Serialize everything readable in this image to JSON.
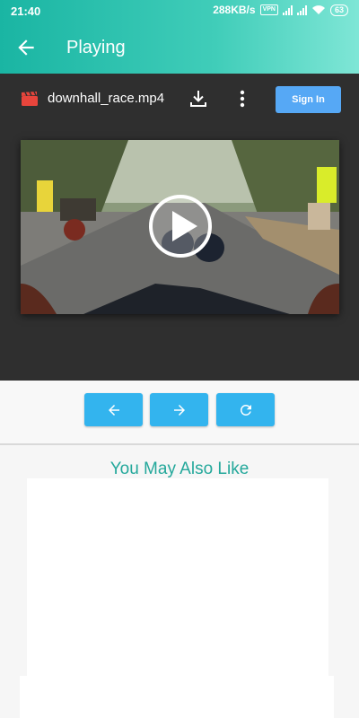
{
  "status": {
    "time": "21:40",
    "speed": "288KB/s",
    "vpn": "VPN",
    "battery": "63"
  },
  "appbar": {
    "title": "Playing",
    "back_icon": "arrow-left-icon"
  },
  "file": {
    "name": "downhall_race.mp4",
    "icon": "clapperboard-icon"
  },
  "actions": {
    "download_icon": "download-icon",
    "more_icon": "more-vert-icon",
    "signin_label": "Sign In"
  },
  "video": {
    "play_icon": "play-icon"
  },
  "controls": {
    "prev_icon": "arrow-left-icon",
    "next_icon": "arrow-right-icon",
    "reload_icon": "refresh-icon"
  },
  "recommendations": {
    "title": "You May Also Like"
  },
  "colors": {
    "accent": "#1ab5a3",
    "button": "#33b4ee",
    "signin": "#56a8f5",
    "heading": "#24a89b"
  }
}
